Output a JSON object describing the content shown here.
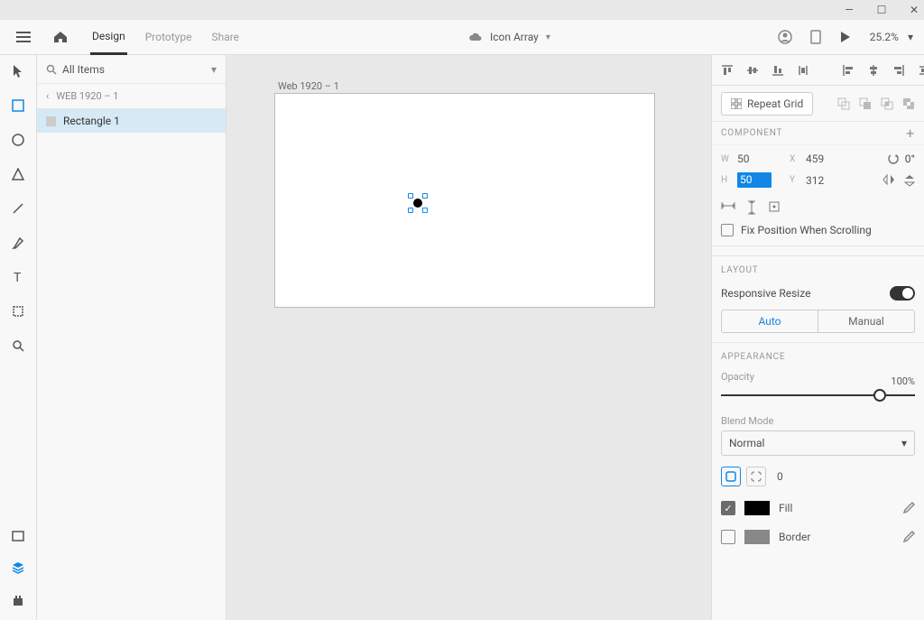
{
  "titlebar": {
    "min": "—",
    "max": "☐",
    "close": "✕"
  },
  "topbar": {
    "tabs": {
      "design": "Design",
      "prototype": "Prototype",
      "share": "Share"
    },
    "doc_title": "Icon Array",
    "zoom": "25.2%"
  },
  "left": {
    "search_label": "All Items",
    "breadcrumb": "WEB 1920 – 1",
    "layer": "Rectangle 1"
  },
  "canvas": {
    "artboard_label": "Web 1920 – 1"
  },
  "right": {
    "repeat": "Repeat Grid",
    "component": "COMPONENT",
    "w_lbl": "W",
    "w": "50",
    "x_lbl": "X",
    "x": "459",
    "rot_lbl": "0°",
    "h_lbl": "H",
    "h": "50",
    "y_lbl": "Y",
    "y": "312",
    "fix": "Fix Position When Scrolling",
    "layout_h": "LAYOUT",
    "resp": "Responsive Resize",
    "auto": "Auto",
    "manual": "Manual",
    "appearance_h": "APPEARANCE",
    "op_lbl": "Opacity",
    "pct": "100%",
    "blend_lbl": "Blend Mode",
    "blend": "Normal",
    "corner": "0",
    "fill": "Fill",
    "border": "Border"
  }
}
